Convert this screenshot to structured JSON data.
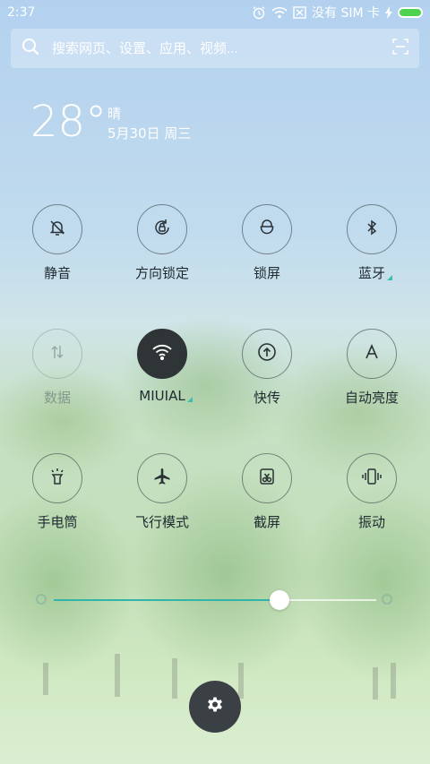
{
  "status": {
    "time": "2:37",
    "carrier": "没有 SIM 卡",
    "battery_color": "#4fd34f"
  },
  "search": {
    "placeholder": "搜索网页、设置、应用、视频...",
    "icon": "search-icon",
    "scan_icon": "scan-icon"
  },
  "weather": {
    "temperature": "28°",
    "condition": "晴",
    "date": "5月30日 周三"
  },
  "toggles": [
    {
      "label": "静音",
      "icon": "bell-mute-icon",
      "state": "off"
    },
    {
      "label": "方向锁定",
      "icon": "rotation-lock-icon",
      "state": "off"
    },
    {
      "label": "锁屏",
      "icon": "lock-icon",
      "state": "off"
    },
    {
      "label": "蓝牙",
      "icon": "bluetooth-icon",
      "state": "off",
      "has_more": true
    },
    {
      "label": "数据",
      "icon": "mobile-data-icon",
      "state": "disabled"
    },
    {
      "label": "MIUIAL",
      "icon": "wifi-icon",
      "state": "on",
      "has_more": true
    },
    {
      "label": "快传",
      "icon": "share-upload-icon",
      "state": "off"
    },
    {
      "label": "自动亮度",
      "icon": "auto-brightness-icon",
      "state": "off"
    },
    {
      "label": "手电筒",
      "icon": "flashlight-icon",
      "state": "off"
    },
    {
      "label": "飞行模式",
      "icon": "airplane-icon",
      "state": "off"
    },
    {
      "label": "截屏",
      "icon": "screenshot-icon",
      "state": "off"
    },
    {
      "label": "振动",
      "icon": "vibrate-icon",
      "state": "off"
    }
  ],
  "brightness": {
    "level": 0.7,
    "accent": "#33b4a8"
  },
  "settings": {
    "icon": "gear-icon"
  }
}
